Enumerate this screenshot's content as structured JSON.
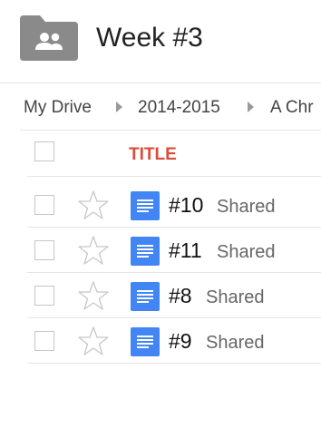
{
  "header": {
    "title": "Week #3",
    "folder_icon": "shared-folder-icon"
  },
  "breadcrumb": [
    {
      "label": "My Drive"
    },
    {
      "label": "2014-2015"
    },
    {
      "label": "A Chr"
    }
  ],
  "table": {
    "title_header": "TITLE",
    "rows": [
      {
        "name": "#10",
        "status": "Shared",
        "icon": "google-doc-icon"
      },
      {
        "name": "#11",
        "status": "Shared",
        "icon": "google-doc-icon"
      },
      {
        "name": "#8",
        "status": "Shared",
        "icon": "google-doc-icon"
      },
      {
        "name": "#9",
        "status": "Shared",
        "icon": "google-doc-icon"
      }
    ]
  },
  "colors": {
    "title_accent": "#dd4b39",
    "doc_blue": "#4285f4",
    "folder_gray": "#8a8a8a"
  }
}
